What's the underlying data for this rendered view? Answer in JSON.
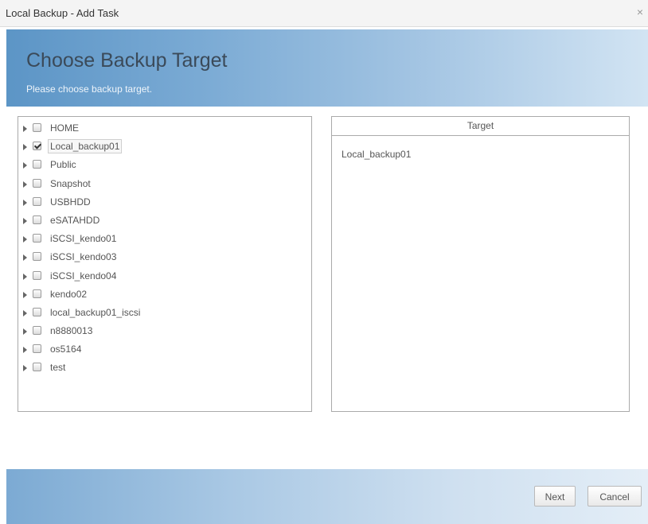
{
  "window": {
    "title": "Local Backup - Add Task",
    "close_glyph": "×"
  },
  "header": {
    "title": "Choose Backup Target",
    "subtitle": "Please choose backup target."
  },
  "tree": {
    "items": [
      {
        "label": "HOME",
        "checked": false
      },
      {
        "label": "Local_backup01",
        "checked": true
      },
      {
        "label": "Public",
        "checked": false
      },
      {
        "label": "Snapshot",
        "checked": false
      },
      {
        "label": "USBHDD",
        "checked": false
      },
      {
        "label": "eSATAHDD",
        "checked": false
      },
      {
        "label": "iSCSI_kendo01",
        "checked": false
      },
      {
        "label": "iSCSI_kendo03",
        "checked": false
      },
      {
        "label": "iSCSI_kendo04",
        "checked": false
      },
      {
        "label": "kendo02",
        "checked": false
      },
      {
        "label": "local_backup01_iscsi",
        "checked": false
      },
      {
        "label": "n8880013",
        "checked": false
      },
      {
        "label": "os5164",
        "checked": false
      },
      {
        "label": "test",
        "checked": false
      }
    ]
  },
  "target": {
    "header": "Target",
    "value": "Local_backup01"
  },
  "footer": {
    "next_label": "Next",
    "cancel_label": "Cancel"
  },
  "colors": {
    "header_gradient_start": "#5c95c6",
    "header_gradient_end": "#d2e4f3",
    "footer_gradient_start": "#7caad3",
    "title_color": "#3b4a59"
  }
}
